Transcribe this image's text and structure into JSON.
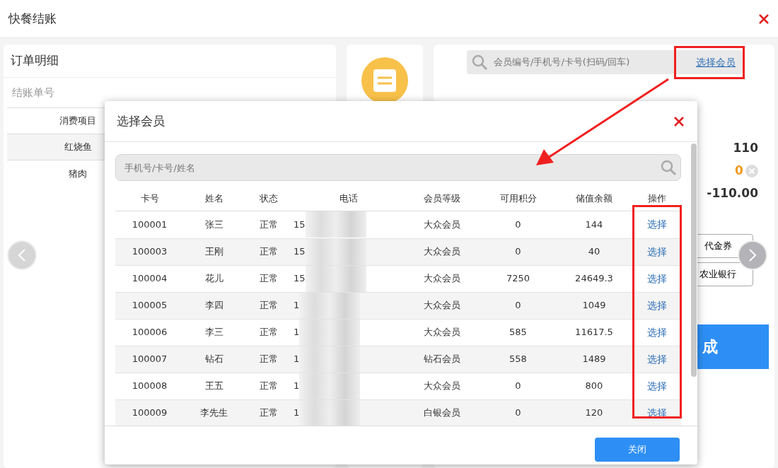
{
  "window": {
    "title": "快餐结账"
  },
  "order_panel": {
    "title": "订单明细",
    "order_no_label": "结账单号",
    "columns": [
      "消费项目"
    ],
    "rows": [
      {
        "item": "红烧鱼"
      },
      {
        "item": "猪肉"
      }
    ]
  },
  "member_panel": {
    "search_placeholder": "会员编号/手机号/卡号(扫码/回车)",
    "select_link": "选择会员",
    "total": "110",
    "discount": "0",
    "balance": "-110.00",
    "payment_buttons": [
      "代金券",
      "农业银行"
    ],
    "confirm_button": "成"
  },
  "modal": {
    "title": "选择会员",
    "search_placeholder": "手机号/卡号/姓名",
    "columns": [
      "卡号",
      "姓名",
      "状态",
      "电话",
      "会员等级",
      "可用积分",
      "储值余额",
      "操作"
    ],
    "rows": [
      {
        "card": "100001",
        "name": "张三",
        "status": "正常",
        "phone": "15",
        "tier": "大众会员",
        "points": "0",
        "balance": "144",
        "action": "选择"
      },
      {
        "card": "100003",
        "name": "王刚",
        "status": "正常",
        "phone": "15",
        "tier": "大众会员",
        "points": "0",
        "balance": "40",
        "action": "选择"
      },
      {
        "card": "100004",
        "name": "花儿",
        "status": "正常",
        "phone": "15",
        "tier": "大众会员",
        "points": "7250",
        "balance": "24649.3",
        "action": "选择"
      },
      {
        "card": "100005",
        "name": "李四",
        "status": "正常",
        "phone": "1",
        "tier": "大众会员",
        "points": "0",
        "balance": "1049",
        "action": "选择"
      },
      {
        "card": "100006",
        "name": "李三",
        "status": "正常",
        "phone": "1",
        "tier": "大众会员",
        "points": "585",
        "balance": "11617.5",
        "action": "选择"
      },
      {
        "card": "100007",
        "name": "钻石",
        "status": "正常",
        "phone": "1",
        "tier": "钻石会员",
        "points": "558",
        "balance": "1489",
        "action": "选择"
      },
      {
        "card": "100008",
        "name": "王五",
        "status": "正常",
        "phone": "1",
        "tier": "大众会员",
        "points": "0",
        "balance": "800",
        "action": "选择"
      },
      {
        "card": "100009",
        "name": "李先生",
        "status": "正常",
        "phone": "1",
        "tier": "白银会员",
        "points": "0",
        "balance": "120",
        "action": "选择"
      }
    ],
    "close_button": "关闭"
  }
}
